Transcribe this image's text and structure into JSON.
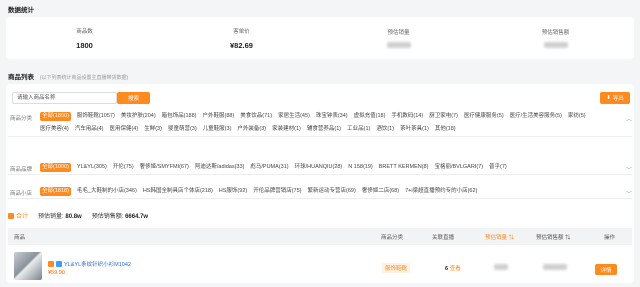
{
  "stats_title": "数据统计",
  "stats": [
    {
      "label": "商品数",
      "value": "1800"
    },
    {
      "label": "客单价",
      "value": "¥82.69"
    },
    {
      "label": "预估销量",
      "value": ""
    },
    {
      "label": "预估销售额",
      "value": ""
    }
  ],
  "list_title": "商品列表",
  "list_hint": "(以下列表统计商品设置主直播带货数据)",
  "search": {
    "placeholder": "请输入商品名称",
    "button": "搜索"
  },
  "export_label": "导出",
  "filters": {
    "category": {
      "label": "商品分类",
      "options": [
        "全部(1800)",
        "服饰鞋靴(1057)",
        "美妆护肤(204)",
        "箱包饰品(188)",
        "户外鞋服(88)",
        "美食饮品(71)",
        "家居生活(45)",
        "珠宝钟表(34)",
        "虚拟充值(18)",
        "手机数码(14)",
        "厨卫家电(7)",
        "医疗健康服务(5)",
        "医疗/生活美容服务(5)",
        "家纺(5)",
        "医疗美容(4)",
        "汽车用品(4)",
        "医用保健(4)",
        "生鲜(3)",
        "婴童萌营(3)",
        "儿童鞋服(3)",
        "户外装备(3)",
        "家装建材(1)",
        "辅食营养品(1)",
        "工业品(1)",
        "酒饮(1)",
        "茶叶茶具(1)",
        "其他(18)"
      ]
    },
    "brand": {
      "label": "商品品牌",
      "options": [
        "全部(1000)",
        "YL&YL(305)",
        "开伦(75)",
        "奢侈姬/SMYFMI(67)",
        "阿迪达斯/adidas(33)",
        "彪马/PUMA(31)",
        "环球/HUANQIU(28)",
        "N 158(19)",
        "BRETT KERMEN(8)",
        "宝格丽/BVLGARI(7)",
        "普乎(7)"
      ]
    },
    "store": {
      "label": "商品小店",
      "options": [
        "全部(1818)",
        "毛毛_大鞋制的小店(346)",
        "HS韩国全制具店个体店(218)",
        "HS服饰(92)",
        "开伦品牌营销店(75)",
        "繁新运动专营店(69)",
        "奢侈姬二店(68)",
        "7+i梁超直播预约专的小店(62)"
      ]
    }
  },
  "summary": {
    "total_label": "合计",
    "sales_label": "预估销量:",
    "sales_value": "80.8w",
    "revenue_label": "预估销售额:",
    "revenue_value": "6664.7w"
  },
  "table": {
    "headers": [
      "商品",
      "商品分类",
      "关联直播",
      "预估销量",
      "预估销售额",
      "操作"
    ],
    "rows": [
      {
        "name": "YL&YL条纹针织小衫M1042",
        "price": "¥59.90",
        "category": "服饰鞋靴",
        "live_count": "6",
        "live_suffix": "查看",
        "action": "详情"
      }
    ]
  },
  "colors": {
    "accent": "#ff8a1f",
    "link": "#2a6ad5",
    "price": "#ff5a00"
  }
}
